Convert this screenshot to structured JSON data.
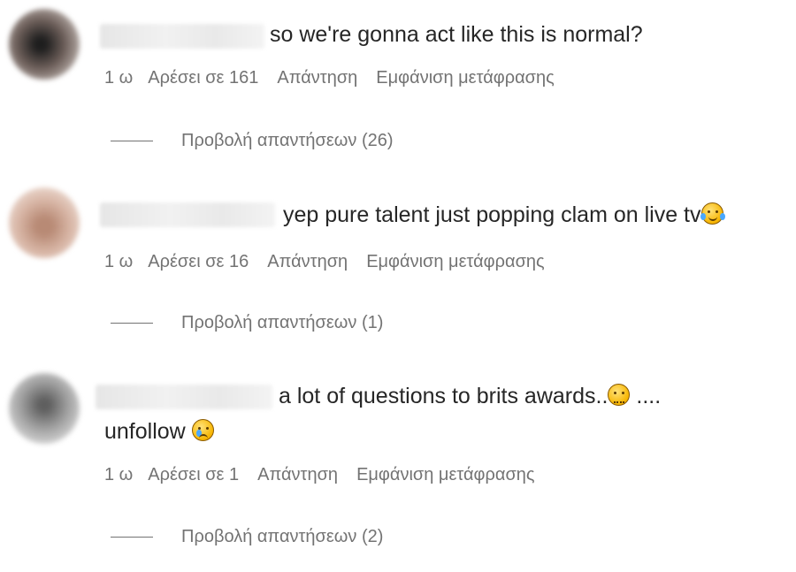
{
  "comments": [
    {
      "text": "so we're gonna act like this is normal?",
      "time": "1 ω",
      "likes": "Αρέσει σε 161",
      "reply": "Απάντηση",
      "translate": "Εμφάνιση μετάφρασης",
      "view_replies": "Προβολή απαντήσεων (26)",
      "avatar_color": "#5a4a44"
    },
    {
      "text": "yep pure talent just popping clam on live tv",
      "time": "1 ω",
      "likes": "Αρέσει σε 16",
      "reply": "Απάντηση",
      "translate": "Εμφάνιση μετάφρασης",
      "view_replies": "Προβολή απαντήσεων (1)",
      "avatar_color": "#c7a08e"
    },
    {
      "text": "a lot of questions to brits awards..",
      "text_tail": "....",
      "text_line2": "unfollow",
      "time": "1 ω",
      "likes": "Αρέσει σε 1",
      "reply": "Απάντηση",
      "translate": "Εμφάνιση μετάφρασης",
      "view_replies": "Προβολή απαντήσεων (2)",
      "avatar_color": "#9a9a9a"
    }
  ],
  "icons": [
    "laughing-tears-emoji",
    "woozy-face-emoji",
    "crying-face-emoji"
  ],
  "colors": {
    "text": "#262626",
    "meta": "#737373",
    "background": "#ffffff"
  }
}
